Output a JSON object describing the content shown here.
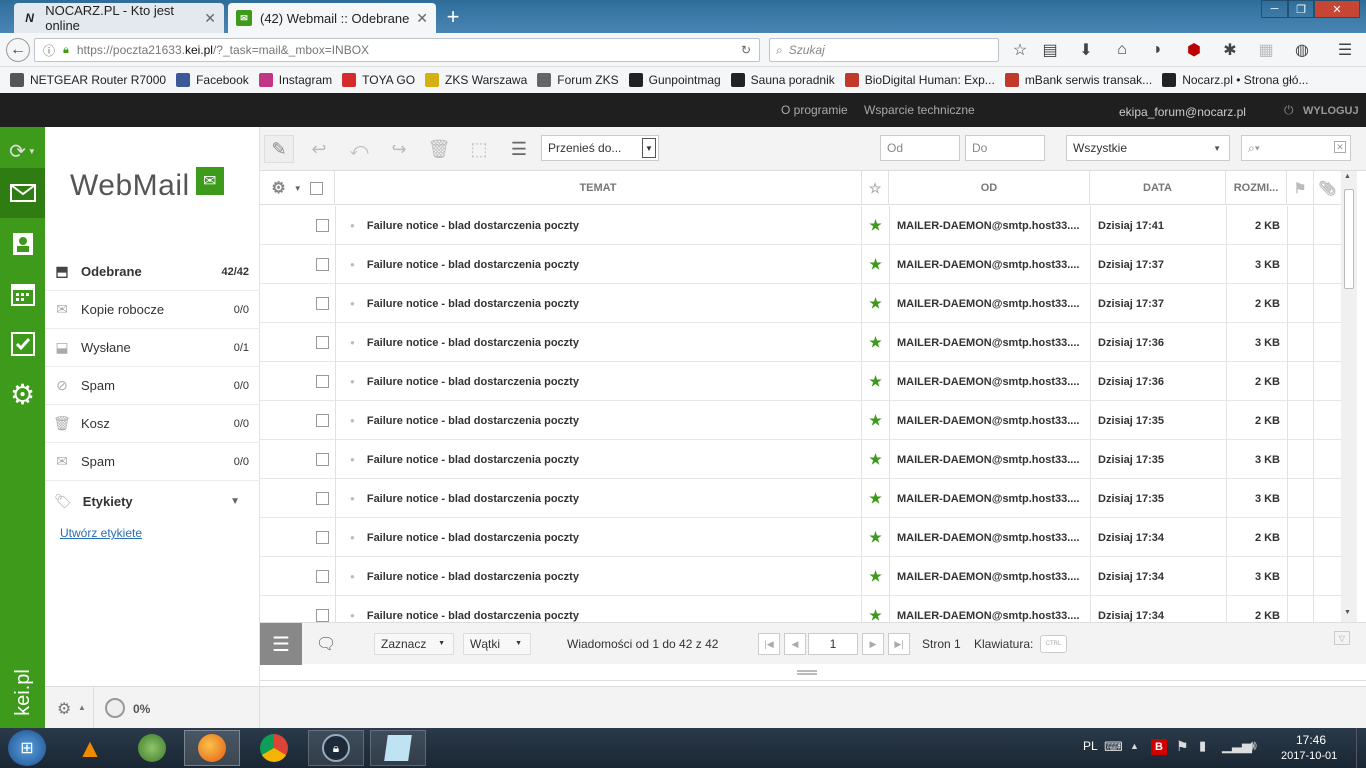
{
  "browser": {
    "tabs": [
      {
        "label": "NOCARZ.PL - Kto jest online",
        "active": false
      },
      {
        "label": "(42) Webmail :: Odebrane",
        "active": true
      }
    ],
    "url": {
      "prefix": "https://poczta21633.",
      "domain": "kei.pl",
      "path": "/?_task=mail&_mbox=INBOX"
    },
    "search_placeholder": "Szukaj",
    "bookmarks": [
      {
        "label": "NETGEAR Router R7000",
        "icon_color": "#555"
      },
      {
        "label": "Facebook",
        "icon_color": "#3b5998"
      },
      {
        "label": "Instagram",
        "icon_color": "#c13584"
      },
      {
        "label": "TOYA GO",
        "icon_color": "#d62b2b"
      },
      {
        "label": "ZKS Warszawa",
        "icon_color": "#d4b013"
      },
      {
        "label": "Forum ZKS",
        "icon_color": "#666"
      },
      {
        "label": "Gunpointmag",
        "icon_color": "#222"
      },
      {
        "label": "Sauna poradnik",
        "icon_color": "#222"
      },
      {
        "label": "BioDigital Human: Exp...",
        "icon_color": "#c0392b"
      },
      {
        "label": "mBank serwis transak...",
        "icon_color": "#c0392b"
      },
      {
        "label": "Nocarz.pl • Strona głó...",
        "icon_color": "#222"
      }
    ]
  },
  "header": {
    "links": [
      "O programie",
      "Wsparcie techniczne"
    ],
    "user": "ekipa_forum@nocarz.pl",
    "logout": "WYLOGUJ"
  },
  "logo": {
    "text": "WebMail"
  },
  "brand": {
    "text": "kei.pl",
    "color": "#3d9a1b"
  },
  "folders": [
    {
      "label": "Odebrane",
      "count": "42/42",
      "icon": "inbox-icon",
      "active": true
    },
    {
      "label": "Kopie robocze",
      "count": "0/0",
      "icon": "drafts-icon"
    },
    {
      "label": "Wysłane",
      "count": "0/1",
      "icon": "sent-icon"
    },
    {
      "label": "Spam",
      "count": "0/0",
      "icon": "spam-icon"
    },
    {
      "label": "Kosz",
      "count": "0/0",
      "icon": "trash-icon"
    },
    {
      "label": "Spam",
      "count": "0/0",
      "icon": "mail-icon"
    }
  ],
  "labels_section": {
    "title": "Etykiety",
    "create_link": "Utwórz etykiete"
  },
  "toolbar": {
    "move_to": "Przenieś do...",
    "from_placeholder": "Od",
    "to_placeholder": "Do",
    "filter_value": "Wszystkie"
  },
  "columns": {
    "subject": "TEMAT",
    "from": "OD",
    "date": "DATA",
    "size": "ROZMI..."
  },
  "messages": [
    {
      "subject": "Failure notice - blad dostarczenia poczty",
      "from": "MAILER-DAEMON@smtp.host33....",
      "date": "Dzisiaj 17:41",
      "size": "2 KB"
    },
    {
      "subject": "Failure notice - blad dostarczenia poczty",
      "from": "MAILER-DAEMON@smtp.host33....",
      "date": "Dzisiaj 17:37",
      "size": "3 KB"
    },
    {
      "subject": "Failure notice - blad dostarczenia poczty",
      "from": "MAILER-DAEMON@smtp.host33....",
      "date": "Dzisiaj 17:37",
      "size": "2 KB"
    },
    {
      "subject": "Failure notice - blad dostarczenia poczty",
      "from": "MAILER-DAEMON@smtp.host33....",
      "date": "Dzisiaj 17:36",
      "size": "3 KB"
    },
    {
      "subject": "Failure notice - blad dostarczenia poczty",
      "from": "MAILER-DAEMON@smtp.host33....",
      "date": "Dzisiaj 17:36",
      "size": "2 KB"
    },
    {
      "subject": "Failure notice - blad dostarczenia poczty",
      "from": "MAILER-DAEMON@smtp.host33....",
      "date": "Dzisiaj 17:35",
      "size": "2 KB"
    },
    {
      "subject": "Failure notice - blad dostarczenia poczty",
      "from": "MAILER-DAEMON@smtp.host33....",
      "date": "Dzisiaj 17:35",
      "size": "3 KB"
    },
    {
      "subject": "Failure notice - blad dostarczenia poczty",
      "from": "MAILER-DAEMON@smtp.host33....",
      "date": "Dzisiaj 17:35",
      "size": "3 KB"
    },
    {
      "subject": "Failure notice - blad dostarczenia poczty",
      "from": "MAILER-DAEMON@smtp.host33....",
      "date": "Dzisiaj 17:34",
      "size": "2 KB"
    },
    {
      "subject": "Failure notice - blad dostarczenia poczty",
      "from": "MAILER-DAEMON@smtp.host33....",
      "date": "Dzisiaj 17:34",
      "size": "3 KB"
    },
    {
      "subject": "Failure notice - blad dostarczenia poczty",
      "from": "MAILER-DAEMON@smtp.host33....",
      "date": "Dzisiaj 17:34",
      "size": "2 KB"
    }
  ],
  "list_footer": {
    "select_label": "Zaznacz",
    "threads_label": "Wątki",
    "count_text": "Wiadomości od 1 do 42 z 42",
    "page_value": "1",
    "pages_text": "Stron 1",
    "keyboard_label": "Klawiatura:",
    "keyboard_key": "CTRL"
  },
  "quota": {
    "text": "0%"
  },
  "taskbar": {
    "lang": "PL",
    "time": "17:46",
    "date": "2017-10-01"
  }
}
